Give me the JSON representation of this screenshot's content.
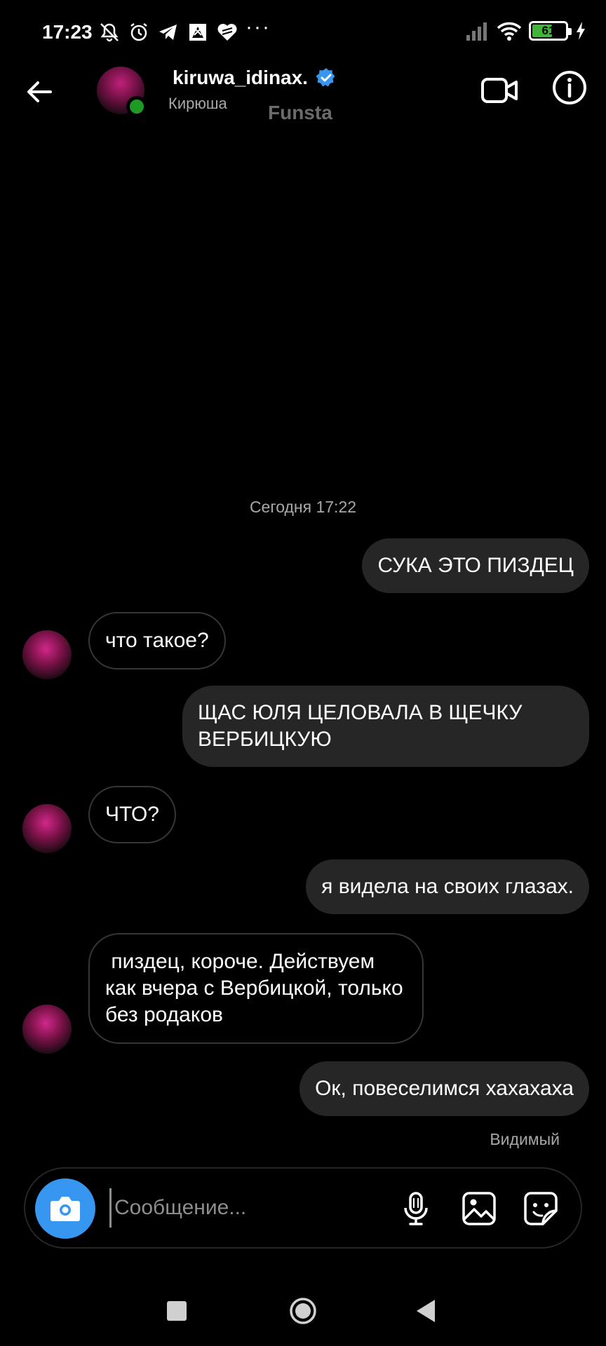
{
  "status_bar": {
    "time": "17:23",
    "more": "···",
    "battery": "61",
    "battery_percent": 61
  },
  "header": {
    "username": "kiruwa_idinax.",
    "display_name": "Кирюша",
    "watermark": "Funsta",
    "verified": true,
    "online": true
  },
  "chat": {
    "date_separator": "Сегодня 17:22",
    "messages": [
      {
        "direction": "out",
        "text": "СУКА ЭТО ПИЗДЕЦ"
      },
      {
        "direction": "in",
        "text": "что такое?"
      },
      {
        "direction": "out",
        "text": "ЩАС ЮЛЯ ЦЕЛОВАЛА В ЩЕЧКУ ВЕРБИЦКУЮ"
      },
      {
        "direction": "in",
        "text": "ЧТО?"
      },
      {
        "direction": "out",
        "text": "я видела на своих глазах."
      },
      {
        "direction": "in",
        "text": " пиздец, короче. Действуем как вчера с Вербицкой, только без родаков"
      },
      {
        "direction": "out",
        "text": "Ок, повеселимся хахахаха"
      }
    ],
    "seen_label": "Видимый"
  },
  "composer": {
    "placeholder": "Сообщение..."
  },
  "icons": {
    "back": "arrow-left-icon",
    "video": "video-camera-icon",
    "info": "info-icon",
    "camera": "camera-icon",
    "mic": "microphone-icon",
    "gallery": "image-icon",
    "sticker": "sticker-icon"
  },
  "colors": {
    "accent": "#3797f0",
    "outgoing_bubble": "#262626",
    "online": "#1f9a25",
    "muted_text": "#a8a8a8"
  }
}
